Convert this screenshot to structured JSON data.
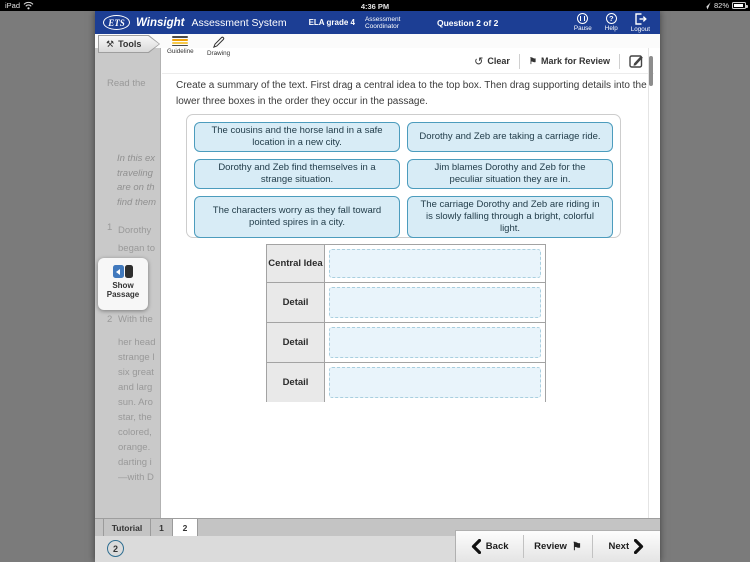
{
  "status_bar": {
    "device": "iPad",
    "time": "4:36 PM",
    "battery": "82%"
  },
  "header": {
    "logo_text": "ETS",
    "brand": "Winsight",
    "product": "Assessment System",
    "course": "ELA grade 4",
    "role": "Assessment Coordinator",
    "question_counter": "Question 2 of 2",
    "pause_label": "Pause",
    "help_label": "Help",
    "help_glyph": "?",
    "logout_label": "Logout"
  },
  "toolbar": {
    "tools_label": "Tools",
    "tools_glyph": "⚒",
    "guideline_label": "Guideline",
    "drawing_label": "Drawing"
  },
  "review_bar": {
    "clear_glyph": "↺",
    "clear_label": "Clear",
    "mark_glyph": "⚑",
    "mark_label": "Mark for Review"
  },
  "question": {
    "prompt": "Create a summary of the text. First drag a central idea to the top box. Then drag supporting details into the lower three boxes in the order they occur in the passage.",
    "options": [
      "The cousins and the horse land in a safe location in a new city.",
      "Dorothy and Zeb are taking a carriage ride.",
      "Dorothy and Zeb find themselves in a strange situation.",
      "Jim blames Dorothy and Zeb for the peculiar situation they are in.",
      "The characters worry as they fall toward pointed spires in a city.",
      "The carriage Dorothy and Zeb are riding in is slowly falling through a bright, colorful light."
    ],
    "table_labels": [
      "Central Idea",
      "Detail",
      "Detail",
      "Detail"
    ]
  },
  "passage_panel": {
    "line_intro": "Read the",
    "italic_lines": [
      "In this ex",
      "traveling",
      "are on th",
      "find them"
    ],
    "p1_num": "1",
    "p1_lines": [
      "Dorothy",
      "began to"
    ],
    "p2_num": "2",
    "p2_first": "With the",
    "p2_lines": [
      "her head",
      "strange l",
      "six great",
      "and larg",
      "sun. Aro",
      "star, the",
      "colored,",
      "orange.",
      "darting i",
      "—with D"
    ],
    "show_passage_label": "Show Passage"
  },
  "footer": {
    "tabs": [
      "Tutorial",
      "1",
      "2"
    ],
    "page_badge": "2",
    "back_label": "Back",
    "review_label": "Review",
    "review_glyph": "⚑",
    "next_label": "Next"
  },
  "colors": {
    "header_blue": "#1c3e94",
    "option_fill": "#d8ecf6",
    "option_border": "#4c9cbd",
    "dropzone_fill": "#e9f4fb",
    "guideline_orange": "#ef9f06"
  }
}
